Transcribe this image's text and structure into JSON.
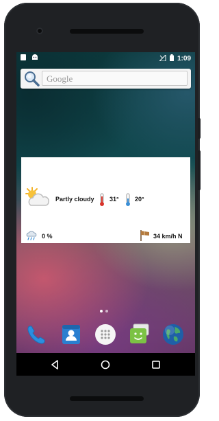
{
  "status_bar": {
    "time": "1:09",
    "left_icons": [
      "sim-card-icon",
      "android-icon"
    ],
    "right_icons": [
      "signal-off-icon",
      "battery-icon"
    ]
  },
  "search": {
    "placeholder": "Google",
    "icon": "magnifier-icon"
  },
  "weather": {
    "condition": "Partly cloudy",
    "high": "31°",
    "low": "20°",
    "precipitation": "0 %",
    "wind": "34 km/h N",
    "icons": [
      "partly-cloudy-icon",
      "thermometer-hot-icon",
      "thermometer-cold-icon",
      "rain-cloud-icon",
      "wind-sock-icon"
    ]
  },
  "home": {
    "page_count": 2,
    "current_page": 1
  },
  "dock": {
    "apps": [
      {
        "name": "phone-icon"
      },
      {
        "name": "contacts-icon"
      },
      {
        "name": "app-drawer-icon"
      },
      {
        "name": "messaging-icon"
      },
      {
        "name": "browser-globe-icon"
      }
    ]
  },
  "nav": {
    "buttons": [
      "back-icon",
      "home-icon",
      "recents-icon"
    ]
  },
  "colors": {
    "accent_blue": "#2a7fd0",
    "android_green": "#7cc245",
    "nav_bar": "#000000"
  }
}
